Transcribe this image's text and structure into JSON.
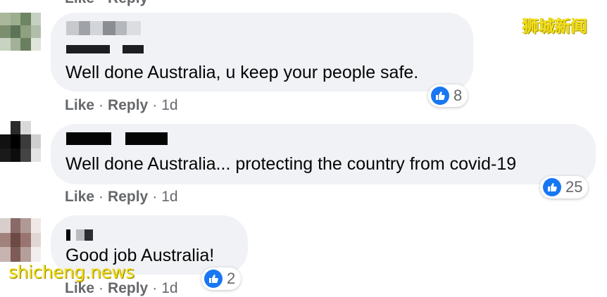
{
  "watermark": {
    "top": "狮城新闻",
    "bottom": "shicheng.news"
  },
  "comments": [
    {
      "text": "Well done Australia, u keep your people safe.",
      "like_label": "Like",
      "reply_label": "Reply",
      "separator": "·",
      "age": "1d",
      "reaction_count": "8"
    },
    {
      "text": "Well done Australia... protecting the country from covid-19",
      "like_label": "Like",
      "reply_label": "Reply",
      "separator": "·",
      "age": "1d",
      "reaction_count": "25"
    },
    {
      "text": "Good job Australia!",
      "like_label": "Like",
      "reply_label": "Reply",
      "separator": "·",
      "age": "1d",
      "reaction_count": "2"
    }
  ],
  "colors": {
    "bubble": "#f0f2f5",
    "like_blue": "#1877f2",
    "meta_gray": "#65676b",
    "watermark_yellow": "#f4e01e"
  },
  "icons": {
    "reaction": "like-thumbs-up-icon"
  }
}
